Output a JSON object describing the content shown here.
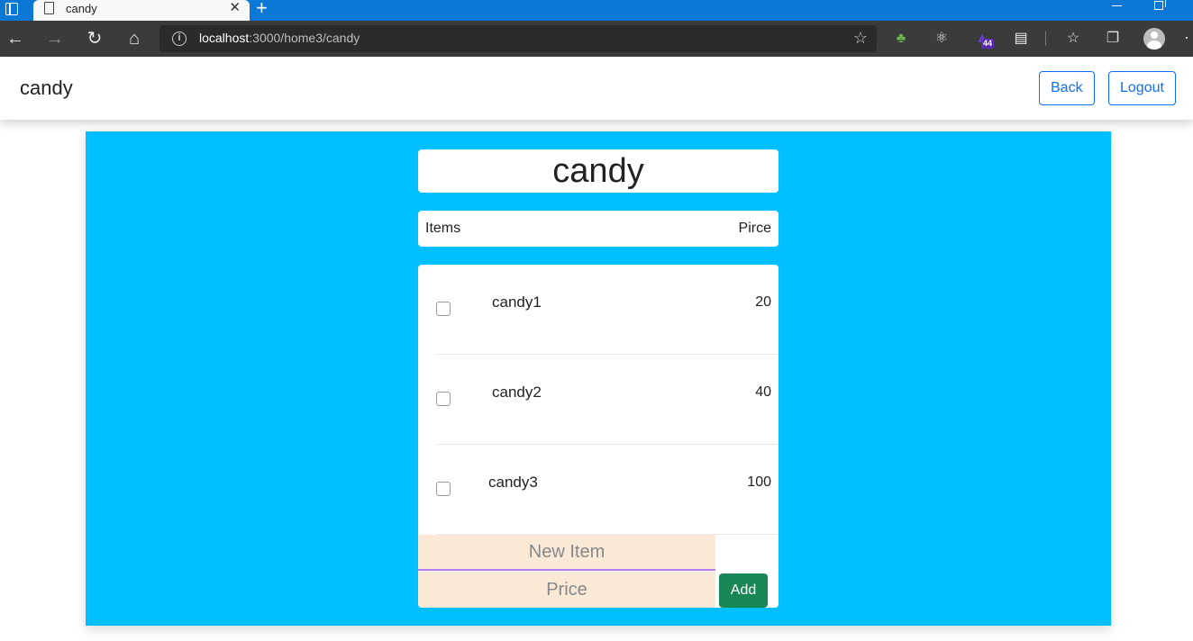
{
  "browser": {
    "tab_title": "candy",
    "url_host": "localhost",
    "url_path": ":3000/home3/candy",
    "extension_badge": "44"
  },
  "header": {
    "title": "candy",
    "back_label": "Back",
    "logout_label": "Logout"
  },
  "main": {
    "title": "candy",
    "col_items": "Items",
    "col_price": "Pirce",
    "items": [
      {
        "name": "candy1",
        "price": "20"
      },
      {
        "name": "candy2",
        "price": "40"
      },
      {
        "name": "candy3",
        "price": "100"
      }
    ],
    "new_item_placeholder": "New Item",
    "price_placeholder": "Price",
    "add_label": "Add"
  },
  "colors": {
    "panel": "#00bfff",
    "input_bg": "#fae9d7",
    "add_button": "#198754",
    "outline_button": "#0d6efd"
  }
}
